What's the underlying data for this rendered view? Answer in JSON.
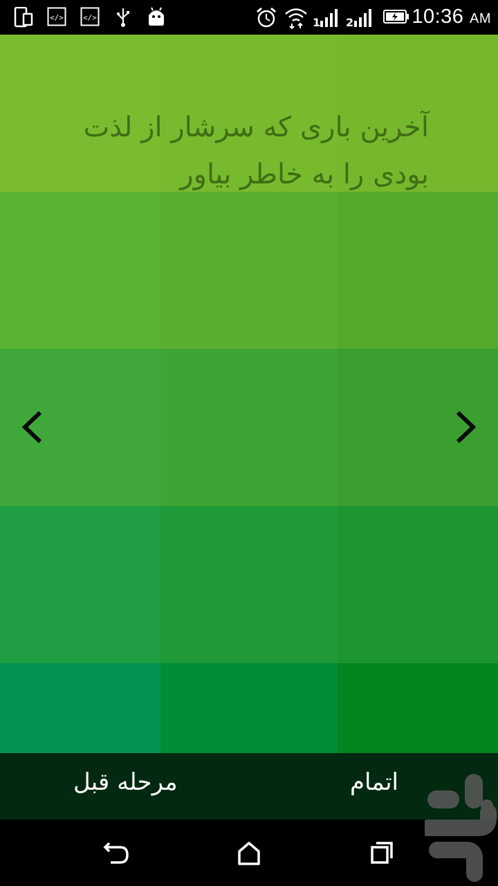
{
  "status_bar": {
    "time": "10:36",
    "ampm": "AM",
    "icons": [
      "phone-portrait-icon",
      "code-icon",
      "code-icon",
      "usb-icon",
      "android-icon",
      "alarm-icon",
      "wifi-icon",
      "signal-1-icon",
      "signal-2-icon",
      "battery-charging-icon"
    ]
  },
  "screen": {
    "prompt_line1": "آخرین باری که سرشار از لذت",
    "prompt_line2": "بودی را به خاطر بیاور",
    "prev_arrow": "chevron-left",
    "next_arrow": "chevron-right"
  },
  "colors": {
    "rows": [
      [
        "#7abc2f",
        "#78ba2e",
        "#76b82c"
      ],
      [
        "#5bb232",
        "#5aae2f",
        "#54a92a"
      ],
      [
        "#40a83a",
        "#3ea535",
        "#3b9e30"
      ],
      [
        "#1f9e44",
        "#209a39",
        "#1d9532"
      ],
      [
        "#049351",
        "#018d37",
        "#03851f"
      ]
    ],
    "text": "#3f6e16",
    "bottom_bar": "#032910"
  },
  "bottom_bar": {
    "finish_label": "اتمام",
    "prev_step_label": "مرحله قبل"
  },
  "nav_bar": {
    "back": "back-icon",
    "home": "home-icon",
    "recents": "recents-icon"
  }
}
